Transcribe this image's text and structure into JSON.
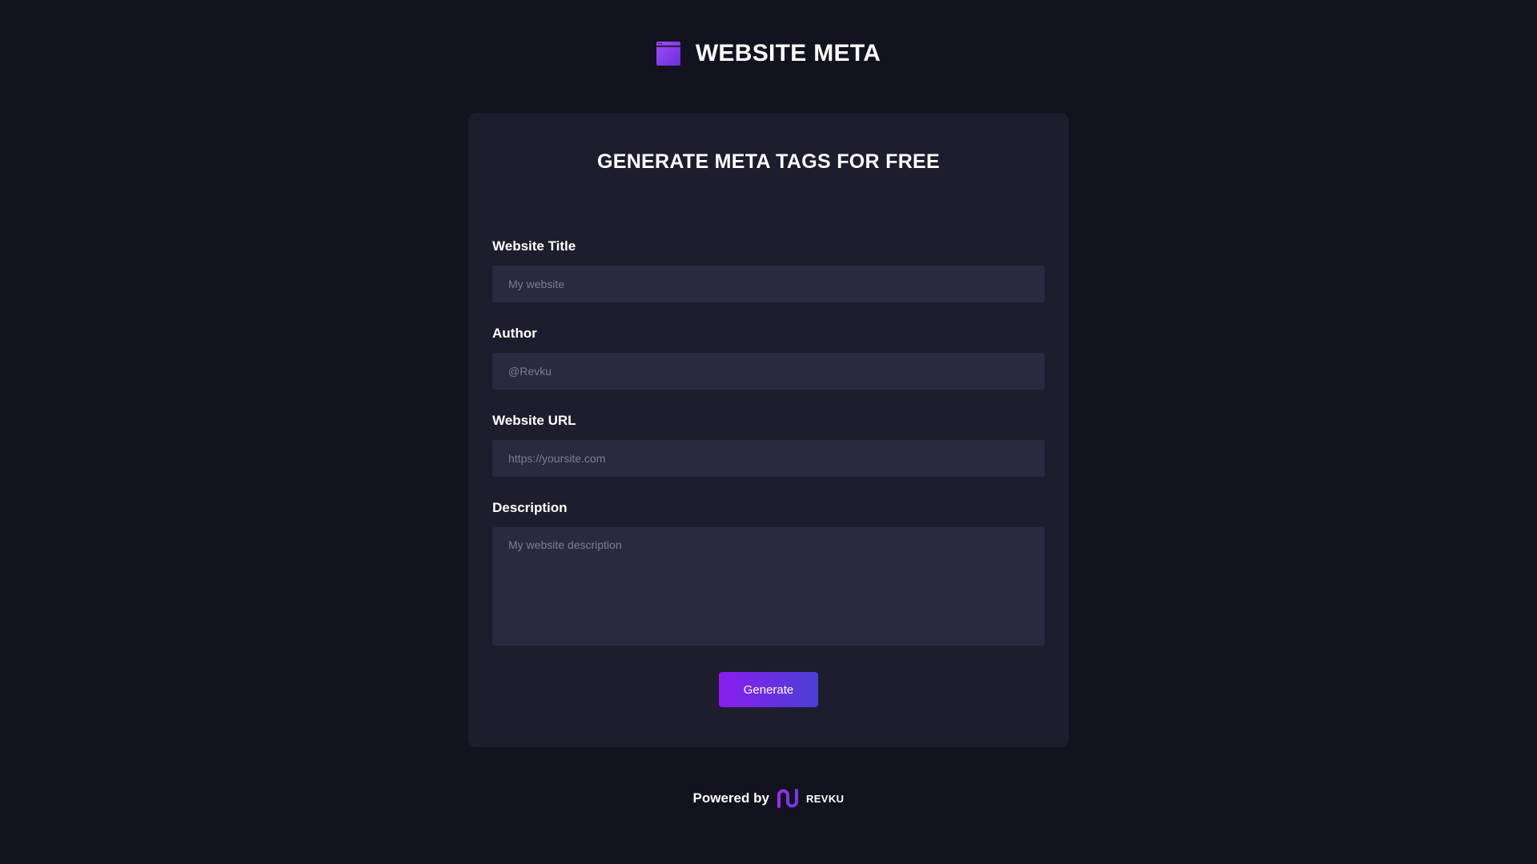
{
  "header": {
    "logo_icon": "browser-window-icon",
    "title": "WEBSITE META"
  },
  "form": {
    "heading": "GENERATE META TAGS FOR FREE",
    "fields": {
      "title": {
        "label": "Website Title",
        "placeholder": "My website",
        "value": ""
      },
      "author": {
        "label": "Author",
        "placeholder": "@Revku",
        "value": ""
      },
      "url": {
        "label": "Website URL",
        "placeholder": "https://yoursite.com",
        "value": ""
      },
      "description": {
        "label": "Description",
        "placeholder": "My website description",
        "value": ""
      }
    },
    "submit_label": "Generate"
  },
  "footer": {
    "powered_by": "Powered by",
    "brand_icon": "revku-logo-icon",
    "brand_name": "REVKU"
  },
  "colors": {
    "background": "#13131f",
    "card": "#1e1d2e",
    "input": "#2a2940",
    "accent_start": "#8a1dee",
    "accent_end": "#4c3fd6"
  }
}
